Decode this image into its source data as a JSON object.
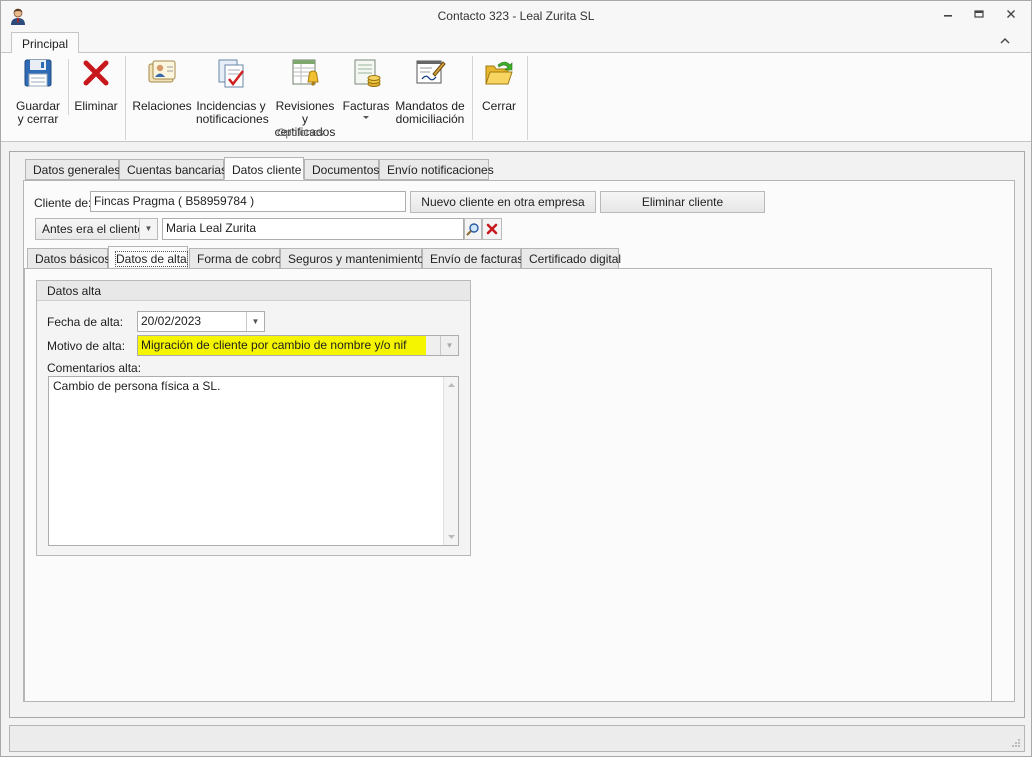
{
  "window": {
    "title": "Contacto 323 - Leal Zurita SL"
  },
  "ribbon": {
    "tab": "Principal",
    "buttons": {
      "guardar": "Guardar\ny cerrar",
      "eliminar": "Eliminar",
      "relaciones": "Relaciones",
      "incidencias": "Incidencias y\nnotificaciones",
      "revisiones": "Revisiones y\ncertificados",
      "facturas": "Facturas",
      "mandatos": "Mandatos de\ndomiciliación",
      "cerrar": "Cerrar"
    },
    "group_label": "Opciones"
  },
  "tabs_main": [
    "Datos generales",
    "Cuentas bancarias",
    "Datos cliente",
    "Documentos",
    "Envío notificaciones"
  ],
  "cliente": {
    "label": "Cliente de:",
    "value": "Fincas Pragma ( B58959784 )",
    "nuevo_btn": "Nuevo cliente en otra empresa",
    "eliminar_btn": "Eliminar cliente",
    "antes_select": "Antes era el cliente",
    "antes_value": "Maria Leal Zurita"
  },
  "tabs_sub": [
    "Datos básicos",
    "Datos de alta",
    "Forma de cobro",
    "Seguros y mantenimientos",
    "Envío de facturas",
    "Certificado digital"
  ],
  "datos_alta": {
    "header": "Datos alta",
    "fecha_label": "Fecha de alta:",
    "fecha_value": "20/02/2023",
    "motivo_label": "Motivo de alta:",
    "motivo_value": "Migración de cliente por cambio de nombre y/o nif",
    "comentarios_label": "Comentarios alta:",
    "comentarios_value": "Cambio de persona física a SL."
  },
  "colors": {
    "highlight": "#f5f500"
  }
}
